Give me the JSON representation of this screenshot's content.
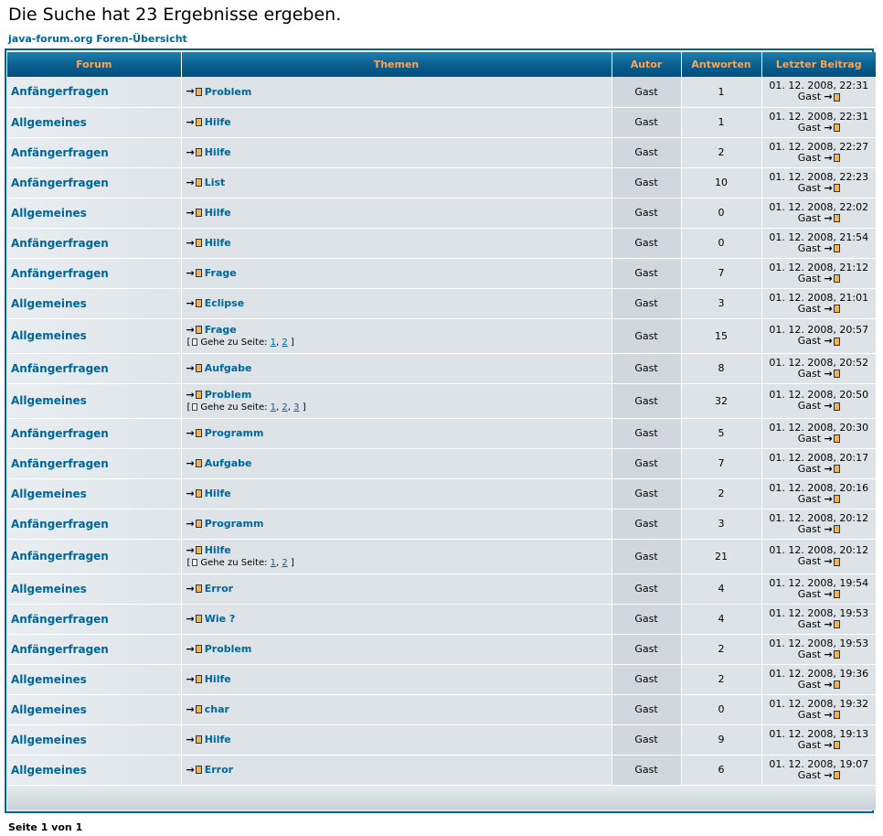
{
  "title": "Die Suche hat 23 Ergebnisse ergeben.",
  "breadcrumb": "java-forum.org Foren-Übersicht",
  "headers": {
    "forum": "Forum",
    "topic": "Themen",
    "author": "Autor",
    "replies": "Antworten",
    "last": "Letzter Beitrag"
  },
  "goto_prefix": "[",
  "goto_label": "Gehe zu Seite:",
  "goto_suffix": "]",
  "rows": [
    {
      "forum": "Anfängerfragen",
      "topic": "Problem",
      "author": "Gast",
      "replies": "1",
      "last_date": "01. 12. 2008, 22:31",
      "last_user": "Gast"
    },
    {
      "forum": "Allgemeines",
      "topic": "Hilfe",
      "author": "Gast",
      "replies": "1",
      "last_date": "01. 12. 2008, 22:31",
      "last_user": "Gast"
    },
    {
      "forum": "Anfängerfragen",
      "topic": "Hilfe",
      "author": "Gast",
      "replies": "2",
      "last_date": "01. 12. 2008, 22:27",
      "last_user": "Gast"
    },
    {
      "forum": "Anfängerfragen",
      "topic": "List",
      "author": "Gast",
      "replies": "10",
      "last_date": "01. 12. 2008, 22:23",
      "last_user": "Gast"
    },
    {
      "forum": "Allgemeines",
      "topic": "Hilfe",
      "author": "Gast",
      "replies": "0",
      "last_date": "01. 12. 2008, 22:02",
      "last_user": "Gast"
    },
    {
      "forum": "Anfängerfragen",
      "topic": "Hilfe",
      "author": "Gast",
      "replies": "0",
      "last_date": "01. 12. 2008, 21:54",
      "last_user": "Gast"
    },
    {
      "forum": "Anfängerfragen",
      "topic": "Frage",
      "author": "Gast",
      "replies": "7",
      "last_date": "01. 12. 2008, 21:12",
      "last_user": "Gast"
    },
    {
      "forum": "Allgemeines",
      "topic": "Eclipse",
      "author": "Gast",
      "replies": "3",
      "last_date": "01. 12. 2008, 21:01",
      "last_user": "Gast"
    },
    {
      "forum": "Allgemeines",
      "topic": "Frage",
      "author": "Gast",
      "replies": "15",
      "last_date": "01. 12. 2008, 20:57",
      "last_user": "Gast",
      "pages": [
        "1",
        "2"
      ]
    },
    {
      "forum": "Anfängerfragen",
      "topic": "Aufgabe",
      "author": "Gast",
      "replies": "8",
      "last_date": "01. 12. 2008, 20:52",
      "last_user": "Gast"
    },
    {
      "forum": "Allgemeines",
      "topic": "Problem",
      "author": "Gast",
      "replies": "32",
      "last_date": "01. 12. 2008, 20:50",
      "last_user": "Gast",
      "pages": [
        "1",
        "2",
        "3"
      ]
    },
    {
      "forum": "Anfängerfragen",
      "topic": "Programm",
      "author": "Gast",
      "replies": "5",
      "last_date": "01. 12. 2008, 20:30",
      "last_user": "Gast"
    },
    {
      "forum": "Anfängerfragen",
      "topic": "Aufgabe",
      "author": "Gast",
      "replies": "7",
      "last_date": "01. 12. 2008, 20:17",
      "last_user": "Gast"
    },
    {
      "forum": "Allgemeines",
      "topic": "Hilfe",
      "author": "Gast",
      "replies": "2",
      "last_date": "01. 12. 2008, 20:16",
      "last_user": "Gast"
    },
    {
      "forum": "Anfängerfragen",
      "topic": "Programm",
      "author": "Gast",
      "replies": "3",
      "last_date": "01. 12. 2008, 20:12",
      "last_user": "Gast"
    },
    {
      "forum": "Anfängerfragen",
      "topic": "Hilfe",
      "author": "Gast",
      "replies": "21",
      "last_date": "01. 12. 2008, 20:12",
      "last_user": "Gast",
      "pages": [
        "1",
        "2"
      ]
    },
    {
      "forum": "Allgemeines",
      "topic": "Error",
      "author": "Gast",
      "replies": "4",
      "last_date": "01. 12. 2008, 19:54",
      "last_user": "Gast"
    },
    {
      "forum": "Anfängerfragen",
      "topic": "Wie ?",
      "author": "Gast",
      "replies": "4",
      "last_date": "01. 12. 2008, 19:53",
      "last_user": "Gast"
    },
    {
      "forum": "Anfängerfragen",
      "topic": "Problem",
      "author": "Gast",
      "replies": "2",
      "last_date": "01. 12. 2008, 19:53",
      "last_user": "Gast"
    },
    {
      "forum": "Allgemeines",
      "topic": "Hilfe",
      "author": "Gast",
      "replies": "2",
      "last_date": "01. 12. 2008, 19:36",
      "last_user": "Gast"
    },
    {
      "forum": "Allgemeines",
      "topic": "char",
      "author": "Gast",
      "replies": "0",
      "last_date": "01. 12. 2008, 19:32",
      "last_user": "Gast"
    },
    {
      "forum": "Allgemeines",
      "topic": "Hilfe",
      "author": "Gast",
      "replies": "9",
      "last_date": "01. 12. 2008, 19:13",
      "last_user": "Gast"
    },
    {
      "forum": "Allgemeines",
      "topic": "Error",
      "author": "Gast",
      "replies": "6",
      "last_date": "01. 12. 2008, 19:07",
      "last_user": "Gast"
    }
  ],
  "page_count": "Seite 1 von 1",
  "colors": {
    "link": "#006699",
    "header_text": "#ffa34f",
    "header_bg": "#0a5d8c",
    "row_bg": "#dee3e7",
    "author_bg": "#d1d7dc"
  },
  "icons": {
    "topic": "arrow-folder-icon",
    "goto": "page-icon",
    "last_post": "arrow-folder-icon"
  }
}
